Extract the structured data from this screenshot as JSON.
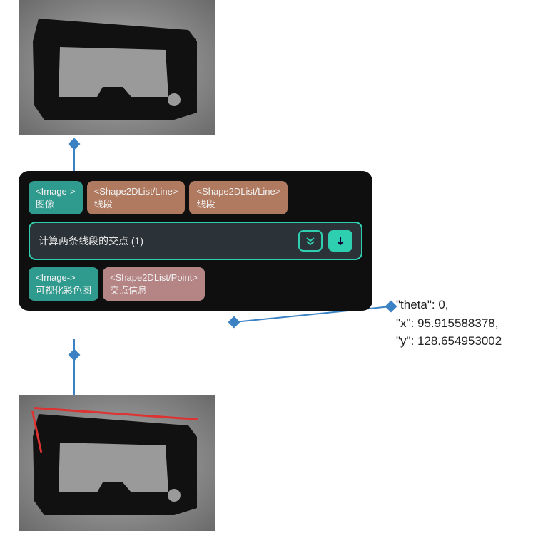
{
  "node": {
    "inputs": [
      {
        "type": "<Image->",
        "label": "图像"
      },
      {
        "type": "<Shape2DList/Line>",
        "label": "线段"
      },
      {
        "type": "<Shape2DList/Line>",
        "label": "线段"
      }
    ],
    "title": "计算两条线段的交点 (1)",
    "outputs": [
      {
        "type": "<Image->",
        "label": "可视化彩色图"
      },
      {
        "type": "<Shape2DList/Point>",
        "label": "交点信息"
      }
    ]
  },
  "result": {
    "line1": "\"theta\": 0,",
    "line2": "\"x\": 95.915588378,",
    "line3": "\"y\": 128.654953002"
  }
}
